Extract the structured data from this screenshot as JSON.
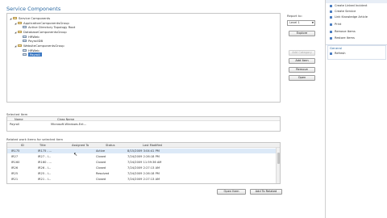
{
  "page_title": "Service Components",
  "tree": [
    {
      "label": "Service Components",
      "level": 0,
      "icon": "folder-icon",
      "expanded": true
    },
    {
      "label": "ApplicationComponentsGroup",
      "level": 1,
      "icon": "folder-icon",
      "expanded": true
    },
    {
      "label": "Active Directory Topology Root",
      "level": 2,
      "icon": "node-icon"
    },
    {
      "label": "DatabaseComponentsGroup",
      "level": 1,
      "icon": "folder-icon",
      "expanded": true
    },
    {
      "label": "HRWeb",
      "level": 2,
      "icon": "node-icon"
    },
    {
      "label": "PayrollDB",
      "level": 2,
      "icon": "node-icon"
    },
    {
      "label": "WebsiteComponentsGroup",
      "level": 1,
      "icon": "folder-icon",
      "expanded": true
    },
    {
      "label": "HRWeb",
      "level": 2,
      "icon": "node-icon"
    },
    {
      "label": "Payroll",
      "level": 2,
      "icon": "node-icon",
      "selected": true
    }
  ],
  "report": {
    "label": "Report to:",
    "value": "Level 1",
    "button": "Explore"
  },
  "actions": {
    "add_category": "Add Category",
    "add_item": "Add Item",
    "remove": "Remove",
    "open": "Open"
  },
  "selected_item": {
    "label": "Selected Item",
    "col_name": "Name",
    "col_class": "Class Name",
    "name": "Payroll",
    "class_name": "Microsoft.Windows.Ent..."
  },
  "work_items": {
    "label": "Related work items for selected item",
    "headers": [
      "ID",
      "Title",
      "Assigned To",
      "Status",
      "Last Modified"
    ],
    "rows": [
      [
        "IR175",
        "IR175 - ...",
        "",
        "Active",
        "8/15/2009 3:04:41 PM"
      ],
      [
        "IR27",
        "IR27 - I...",
        "",
        "Closed",
        "7/24/2009 2:26:18 PM"
      ],
      [
        "IR160",
        "IR160 - ...",
        "",
        "Closed",
        "7/24/2009 11:59:36 AM"
      ],
      [
        "IR26",
        "IR26 - I...",
        "",
        "Closed",
        "7/24/2009 2:27:13 AM"
      ],
      [
        "IR25",
        "IR25 - I...",
        "",
        "Resolved",
        "7/24/2009 2:26:18 PM"
      ],
      [
        "IR21",
        "IR21 - I...",
        "",
        "Closed",
        "7/24/2009 2:27:13 AM"
      ]
    ],
    "open_button": "Open Item",
    "add_button": "Add To Related"
  },
  "tasks": {
    "items": [
      {
        "label": "Create Linked Incident",
        "icon": "incident-icon"
      },
      {
        "label": "Create Service",
        "icon": "service-icon"
      },
      {
        "label": "Link Knowledge Article",
        "icon": "article-icon"
      },
      {
        "label": "Print",
        "icon": "print-icon"
      },
      {
        "label": "Remove Items",
        "icon": "remove-icon"
      },
      {
        "label": "Restore Items",
        "icon": "restore-icon"
      }
    ],
    "section_title": "General",
    "refresh": "Refresh"
  },
  "colors": {
    "accent": "#2c6aa3",
    "selection": "#3b78c2",
    "row_highlight": "#dce9f7"
  }
}
